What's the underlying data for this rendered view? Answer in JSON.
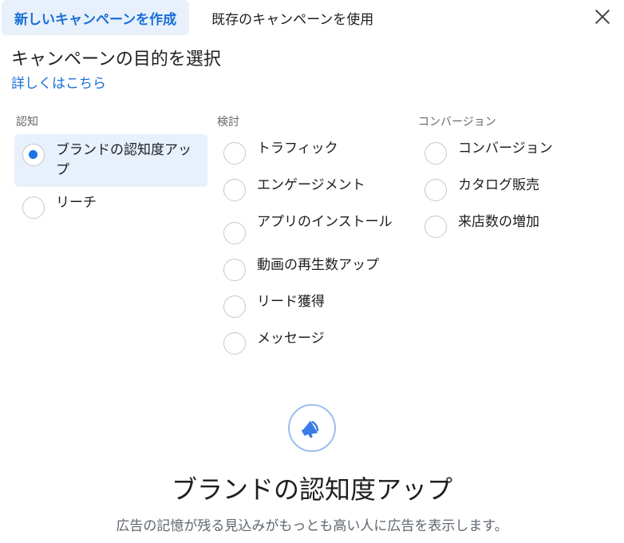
{
  "tabs": {
    "create_new": "新しいキャンペーンを作成",
    "use_existing": "既存のキャンペーンを使用"
  },
  "header": {
    "title": "キャンペーンの目的を選択",
    "learn_more": "詳しくはこちら"
  },
  "columns": [
    {
      "header": "認知",
      "options": [
        {
          "label": "ブランドの認知度アップ",
          "selected": true
        },
        {
          "label": "リーチ",
          "selected": false
        }
      ]
    },
    {
      "header": "検討",
      "options": [
        {
          "label": "トラフィック",
          "selected": false
        },
        {
          "label": "エンゲージメント",
          "selected": false
        },
        {
          "label": "アプリのインストール",
          "selected": false
        },
        {
          "label": "動画の再生数アップ",
          "selected": false
        },
        {
          "label": "リード獲得",
          "selected": false
        },
        {
          "label": "メッセージ",
          "selected": false
        }
      ]
    },
    {
      "header": "コンバージョン",
      "options": [
        {
          "label": "コンバージョン",
          "selected": false
        },
        {
          "label": "カタログ販売",
          "selected": false
        },
        {
          "label": "来店数の増加",
          "selected": false
        }
      ]
    }
  ],
  "detail": {
    "icon": "megaphone-icon",
    "title": "ブランドの認知度アップ",
    "description": "広告の記憶が残る見込みがもっとも高い人に広告を表示します。"
  },
  "colors": {
    "accent": "#1a73e8",
    "selected_bg": "#e7f0fb",
    "link": "#1a6fd6"
  }
}
